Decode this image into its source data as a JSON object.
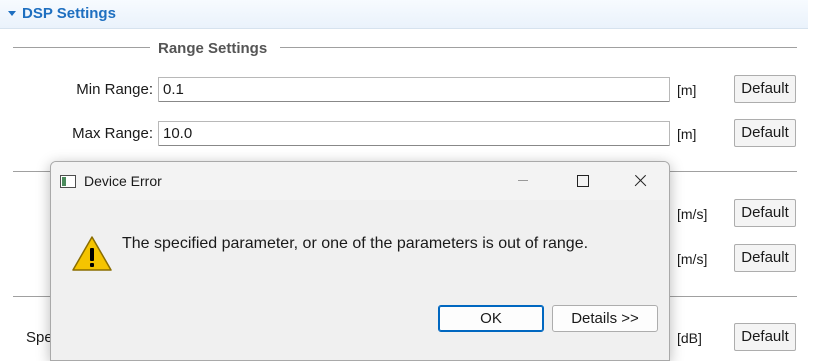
{
  "section": {
    "title": "DSP Settings",
    "toggle_icon": "chevron-down-icon"
  },
  "range_settings": {
    "title": "Range Settings",
    "min": {
      "label": "Min Range:",
      "value": "0.1",
      "unit": "[m]",
      "default_label": "Default"
    },
    "max": {
      "label": "Max Range:",
      "value": "10.0",
      "unit": "[m]",
      "default_label": "Default"
    }
  },
  "hidden_rows": [
    {
      "unit": "[m/s]",
      "default_label": "Default"
    },
    {
      "unit": "[m/s]",
      "default_label": "Default"
    }
  ],
  "bottom_row": {
    "label_partial": "Spe",
    "unit": "[dB]",
    "default_label": "Default"
  },
  "dialog": {
    "title": "Device Error",
    "message": "The specified parameter, or one of the parameters is out of range.",
    "icon": "warning-icon",
    "ok_label": "OK",
    "details_label": "Details >>"
  },
  "colors": {
    "accent": "#1e6fc0",
    "primary_button_border": "#0067c0",
    "warning": "#f5c400"
  }
}
